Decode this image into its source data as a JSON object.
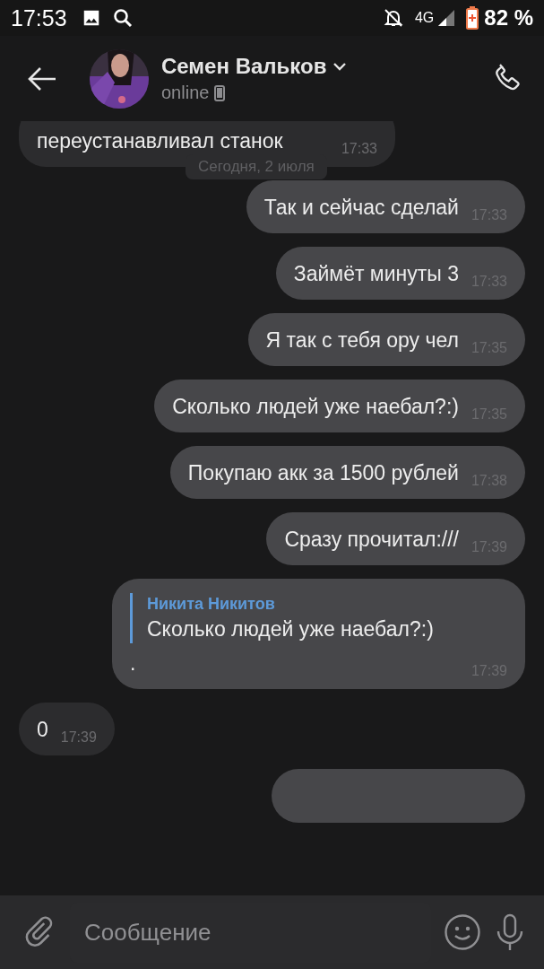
{
  "status_bar": {
    "time": "17:53",
    "network": "4G",
    "battery": "82 %"
  },
  "header": {
    "name": "Семен Вальков",
    "status": "online"
  },
  "date_chip": "Сегодня, 2 июля",
  "messages": [
    {
      "kind": "in",
      "text": "переустанавливал станок",
      "time": "17:33"
    },
    {
      "kind": "out",
      "text": "Так и сейчас сделай",
      "time": "17:33"
    },
    {
      "kind": "out",
      "text": "Займёт минуты 3",
      "time": "17:33"
    },
    {
      "kind": "out",
      "text": "Я так с тебя ору чел",
      "time": "17:35"
    },
    {
      "kind": "out",
      "text": "Сколько людей уже наебал?:)",
      "time": "17:35"
    },
    {
      "kind": "out",
      "text": "Покупаю акк за 1500 рублей",
      "time": "17:38"
    },
    {
      "kind": "out",
      "text": "Сразу прочитал:///",
      "time": "17:39"
    },
    {
      "kind": "out",
      "reply": {
        "author": "Никита Никитов",
        "text": "Сколько людей уже наебал?:)"
      },
      "text": ".",
      "time": "17:39"
    },
    {
      "kind": "in",
      "text": "0",
      "time": "17:39"
    },
    {
      "kind": "out"
    }
  ],
  "composer": {
    "placeholder": "Сообщение"
  }
}
